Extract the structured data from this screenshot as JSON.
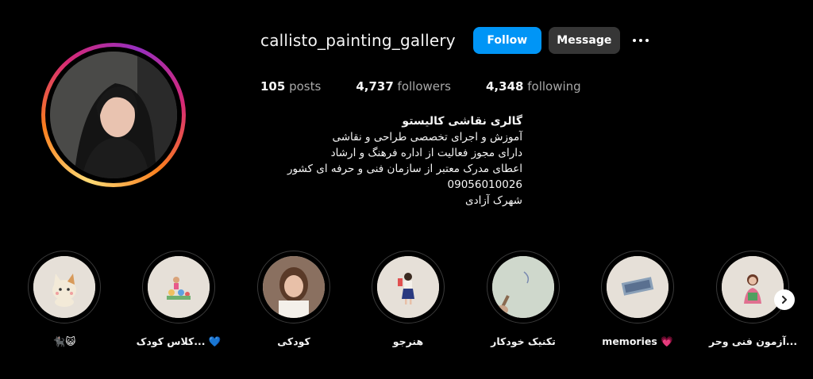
{
  "profile": {
    "username": "callisto_painting_gallery",
    "follow_label": "Follow",
    "message_label": "Message",
    "more_icon": "more-options-icon"
  },
  "stats": {
    "posts_count": "105",
    "posts_label": "posts",
    "followers_count": "4,737",
    "followers_label": "followers",
    "following_count": "4,348",
    "following_label": "following"
  },
  "bio": {
    "name": "گالری نقاشی کالیستو",
    "lines": [
      "آموزش و اجرای تخصصی طراحی و نقاشی",
      "دارای مجوز فعالیت از اداره فرهنگ و ارشاد",
      "اعطای مدرک معتبر از سازمان فنی و حرفه ای کشور",
      "09056010026",
      "شهرک آزادی"
    ]
  },
  "highlights": [
    {
      "label": "🐈‍⬛😺",
      "icon": "cat-sticker"
    },
    {
      "label": "کلاس کودک... 💙",
      "icon": "kids-class-sticker"
    },
    {
      "label": "کودکی",
      "icon": "child-photo"
    },
    {
      "label": "هنرجو",
      "icon": "student-sticker"
    },
    {
      "label": "تکنیک خودکار",
      "icon": "pen-sketch-photo"
    },
    {
      "label": "memories 💗",
      "icon": "memories-sticker"
    },
    {
      "label": "آزمون فنی وحر...",
      "icon": "exam-sticker"
    }
  ],
  "colors": {
    "follow": "#0095f6",
    "message": "#363636",
    "background": "#000000"
  },
  "next_icon": "chevron-right-icon"
}
